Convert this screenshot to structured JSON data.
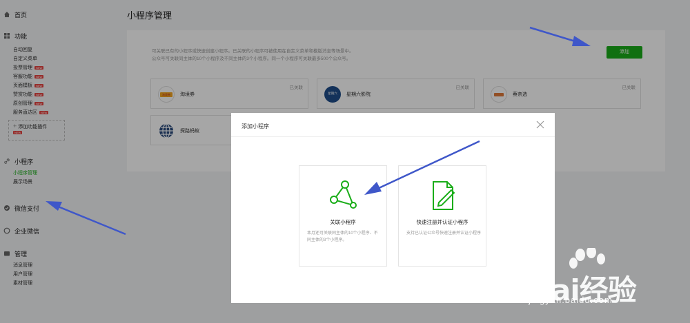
{
  "page": {
    "title": "小程序管理"
  },
  "sidebar": {
    "home": "首页",
    "functions": {
      "label": "功能",
      "items": [
        {
          "label": "自动回复",
          "new": false
        },
        {
          "label": "自定义菜单",
          "new": false
        },
        {
          "label": "投票管理",
          "new": true
        },
        {
          "label": "客服功能",
          "new": true
        },
        {
          "label": "页面模板",
          "new": true
        },
        {
          "label": "赞赏功能",
          "new": true
        },
        {
          "label": "原创管理",
          "new": true
        },
        {
          "label": "服务直达区",
          "new": true
        }
      ],
      "add_plugin": "添加功能插件",
      "new_tag": "NEW"
    },
    "miniprogram": {
      "label": "小程序",
      "items": [
        {
          "label": "小程序管理",
          "active": true
        },
        {
          "label": "展示场景",
          "active": false
        }
      ]
    },
    "pay": "微信支付",
    "enterprise": "企业微信",
    "manage": {
      "label": "管理",
      "items": [
        "消息管理",
        "用户管理",
        "素材管理"
      ]
    }
  },
  "panel": {
    "desc_line1": "可关联已有的小程序或快速创建小程序。已关联的小程序可被使用在自定义菜单和模版消息等场景中。",
    "desc_line2": "公众号可关联同主体的10个小程序及不同主体的3个小程序。同一个小程序可关联最多500个公众号。",
    "add_button": "添加",
    "linked_label": "已关联",
    "cards": [
      {
        "name": "淘境券",
        "logo_text": "淘境券"
      },
      {
        "name": "星期六影院",
        "logo_text": "星期六"
      },
      {
        "name": "蔡奈选",
        "logo_text": ""
      },
      {
        "name": "探路蚂蚁",
        "logo_text": ""
      }
    ]
  },
  "modal": {
    "title": "添加小程序",
    "options": [
      {
        "title": "关联小程序",
        "desc": "本月还可关联同主体的10个小程序、不同主体的3个小程序。"
      },
      {
        "title": "快速注册并认证小程序",
        "desc": "支持已认证公众号快速注册并认证小程序"
      }
    ]
  },
  "watermark": {
    "brand": "Bai经验",
    "url": "jingyan.baidu.com"
  },
  "colors": {
    "accent": "#1aad19",
    "arrow": "#3f57c9",
    "tag": "#e64340"
  }
}
